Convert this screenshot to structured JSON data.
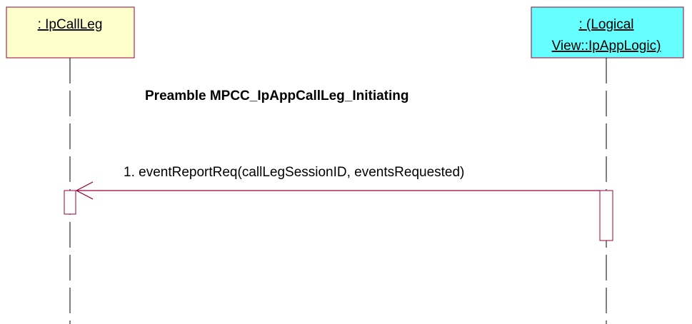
{
  "lifelines": [
    {
      "label_lines": [
        ": IpCallLeg"
      ],
      "fill": "#FFFFCC"
    },
    {
      "label_lines": [
        ": (Logical",
        "View::IpAppLogic)"
      ],
      "fill": "#66FFFF"
    }
  ],
  "title": "Preamble MPCC_IpAppCallLeg_Initiating",
  "messages": [
    {
      "label": "1. eventReportReq(callLegSessionID, eventsRequested)"
    }
  ],
  "colors": {
    "box_border": "#990033",
    "arrow": "#990033",
    "lifeline": "#000000"
  }
}
